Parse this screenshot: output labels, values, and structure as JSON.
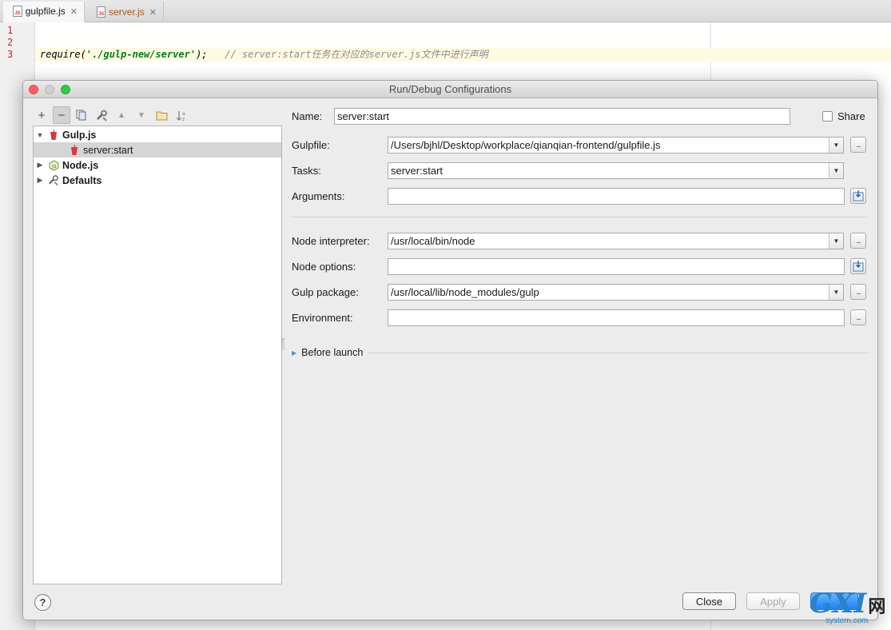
{
  "tabs": [
    {
      "label": "gulpfile.js",
      "icon": "js-file-icon",
      "active": true
    },
    {
      "label": "server.js",
      "icon": "js-file-icon",
      "active": false
    }
  ],
  "editor": {
    "line_numbers": [
      "1",
      "2",
      "3"
    ],
    "code": {
      "fn": "require(",
      "str": "'./gulp-new/server'",
      "end": ");",
      "comment": "// server:start任务在对应的server.js文件中进行声明"
    }
  },
  "dialog": {
    "title": "Run/Debug Configurations",
    "toolbar": {
      "add": "+",
      "remove": "−",
      "copy_icon": "copy-icon",
      "edit_defaults_icon": "wrench-icon",
      "move_up": "▲",
      "move_down": "▼",
      "folder_icon": "folder-icon",
      "sort_icon": "sort-alpha-icon"
    },
    "tree": [
      {
        "label": "Gulp.js",
        "expanded": true,
        "bold": true,
        "icon": "gulp-icon"
      },
      {
        "label": "server:start",
        "selected": true,
        "icon": "gulp-icon"
      },
      {
        "label": "Node.js",
        "expanded": false,
        "bold": true,
        "icon": "nodejs-icon"
      },
      {
        "label": "Defaults",
        "expanded": false,
        "bold": true,
        "icon": "wrench-icon"
      }
    ],
    "form": {
      "name_label": "Name:",
      "name_value": "server:start",
      "share_label": "Share",
      "share_checked": false,
      "gulpfile_label": "Gulpfile:",
      "gulpfile_value": "/Users/bjhl/Desktop/workplace/qianqian-frontend/gulpfile.js",
      "tasks_label": "Tasks:",
      "tasks_value": "server:start",
      "arguments_label": "Arguments:",
      "arguments_value": "",
      "node_interpreter_label": "Node interpreter:",
      "node_interpreter_value": "/usr/local/bin/node",
      "node_options_label": "Node options:",
      "node_options_value": "",
      "gulp_package_label": "Gulp package:",
      "gulp_package_value": "/usr/local/lib/node_modules/gulp",
      "environment_label": "Environment:",
      "environment_value": "",
      "browse_label": "...",
      "before_launch_label": "Before launch"
    },
    "buttons": {
      "help": "?",
      "close": "Close",
      "apply": "Apply"
    }
  },
  "watermark": {
    "brand": "GXI",
    "brand_cn": "网",
    "domain": "system.com"
  }
}
